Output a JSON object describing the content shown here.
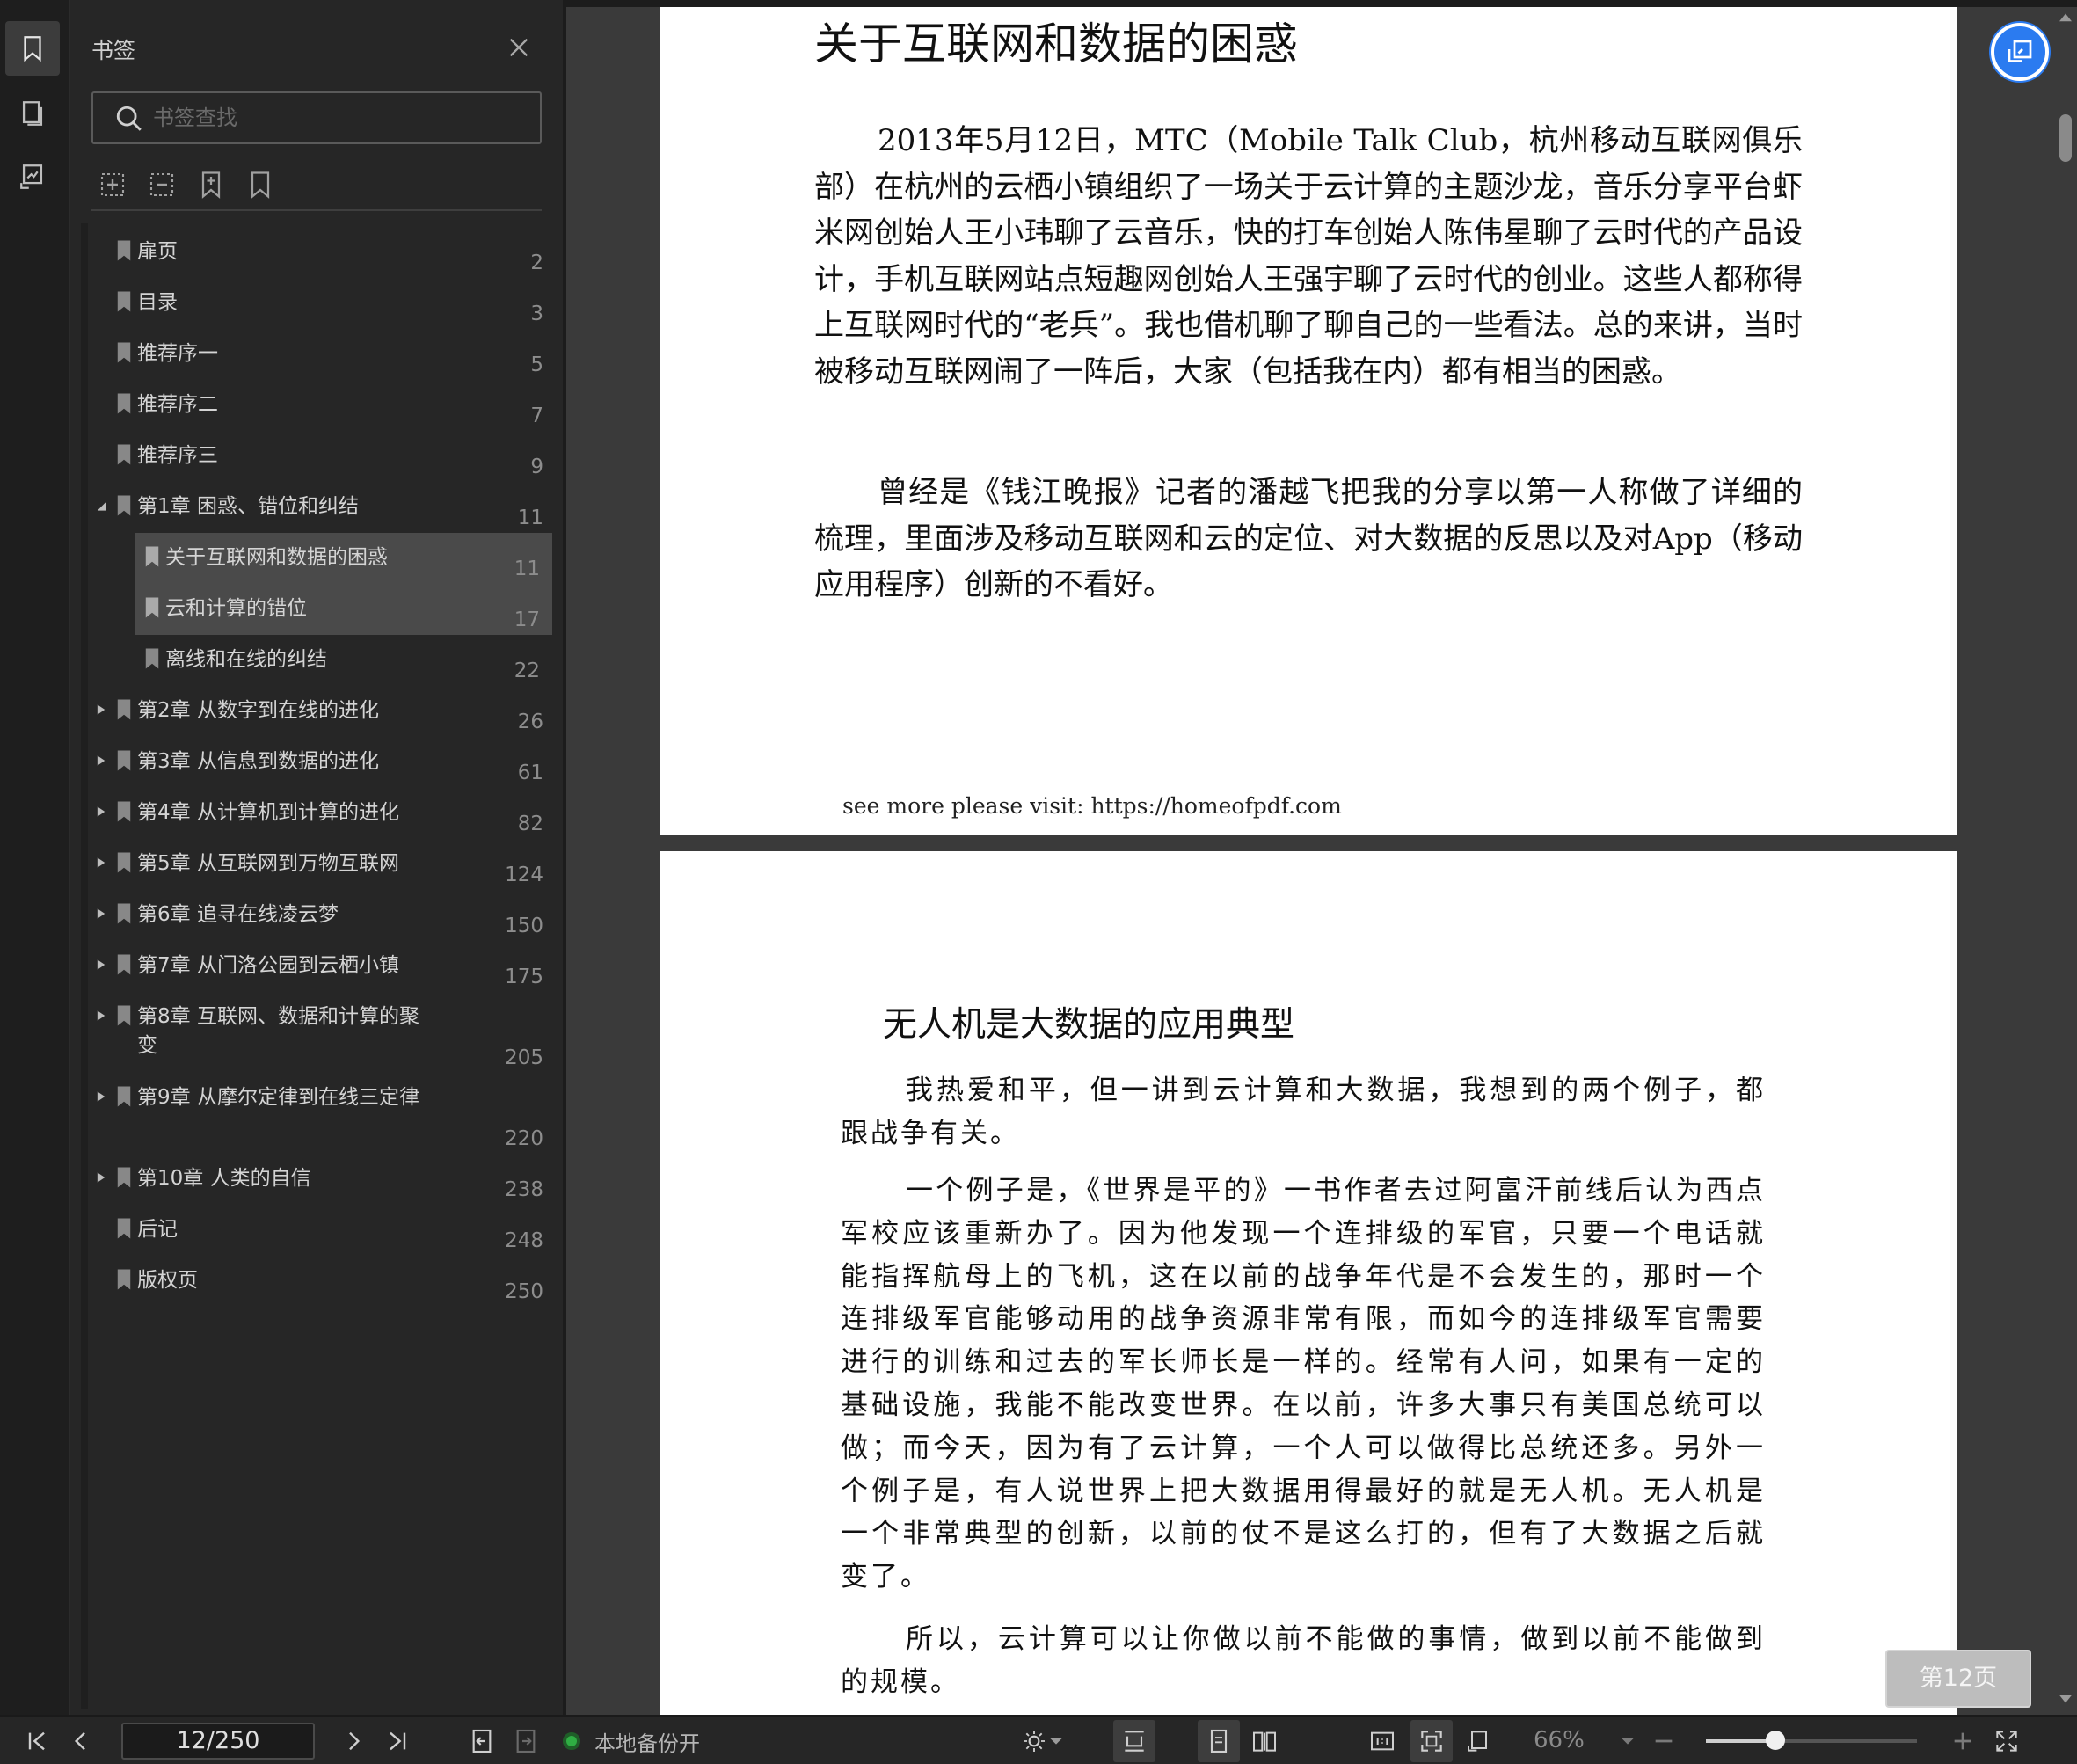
{
  "sidebar_panel": {
    "title": "书签",
    "search_placeholder": "书签查找",
    "bookmarks": [
      {
        "label": "扉页",
        "page": "2"
      },
      {
        "label": "目录",
        "page": "3"
      },
      {
        "label": "推荐序一",
        "page": "5"
      },
      {
        "label": "推荐序二",
        "page": "7"
      },
      {
        "label": "推荐序三",
        "page": "9"
      },
      {
        "label": "第1章 困惑、错位和纠结",
        "page": "11"
      },
      {
        "label": "关于互联网和数据的困惑",
        "page": "11"
      },
      {
        "label": "云和计算的错位",
        "page": "17"
      },
      {
        "label": "离线和在线的纠结",
        "page": "22"
      },
      {
        "label": "第2章 从数字到在线的进化",
        "page": "26"
      },
      {
        "label": "第3章 从信息到数据的进化",
        "page": "61"
      },
      {
        "label": "第4章 从计算机到计算的进化",
        "page": "82"
      },
      {
        "label": "第5章 从互联网到万物互联网",
        "page": "124"
      },
      {
        "label": "第6章 追寻在线凌云梦",
        "page": "150"
      },
      {
        "label": "第7章 从门洛公园到云栖小镇",
        "page": "175"
      },
      {
        "label": "第8章 互联网、数据和计算的聚变",
        "page": "205"
      },
      {
        "label": "第9章 从摩尔定律到在线三定律",
        "page": "220"
      },
      {
        "label": "第10章 人类的自信",
        "page": "238"
      },
      {
        "label": "后记",
        "page": "248"
      },
      {
        "label": "版权页",
        "page": "250"
      }
    ]
  },
  "document": {
    "page1": {
      "title": "关于互联网和数据的困惑",
      "para1": "2013年5月12日，MTC（Mobile Talk Club，杭州移动互联网俱乐部）在杭州的云栖小镇组织了一场关于云计算的主题沙龙，音乐分享平台虾米网创始人王小玮聊了云音乐，快的打车创始人陈伟星聊了云时代的产品设计，手机互联网站点短趣网创始人王强宇聊了云时代的创业。这些人都称得上互联网时代的“老兵”。我也借机聊了聊自己的一些看法。总的来讲，当时被移动互联网闹了一阵后，大家（包括我在内）都有相当的困惑。",
      "para2": "曾经是《钱江晚报》记者的潘越飞把我的分享以第一人称做了详细的梳理，里面涉及移动互联网和云的定位、对大数据的反思以及对App（移动应用程序）创新的不看好。",
      "footer": "see more please visit: https://homeofpdf.com"
    },
    "page2": {
      "title": "无人机是大数据的应用典型",
      "para1": "我热爱和平，但一讲到云计算和大数据，我想到的两个例子，都跟战争有关。",
      "para2": "一个例子是，《世界是平的》一书作者去过阿富汗前线后认为西点军校应该重新办了。因为他发现一个连排级的军官，只要一个电话就能指挥航母上的飞机，这在以前的战争年代是不会发生的，那时一个连排级军官能够动用的战争资源非常有限，而如今的连排级军官需要进行的训练和过去的军长师长是一样的。经常有人问，如果有一定的基础设施，我能不能改变世界。在以前，许多大事只有美国总统可以做；而今天，因为有了云计算，一个人可以做得比总统还多。另外一个例子是，有人说世界上把大数据用得最好的就是无人机。无人机是一个非常典型的创新，以前的仗不是这么打的，但有了大数据之后就变了。",
      "para3": "所以，云计算可以让你做以前不能做的事情，做到以前不能做到的规模。"
    },
    "page_badge": "第12页"
  },
  "statusbar": {
    "page_indicator": "12/250",
    "backup_label": "本地备份开",
    "zoom": "66%",
    "zoom_fraction": 0.33
  }
}
